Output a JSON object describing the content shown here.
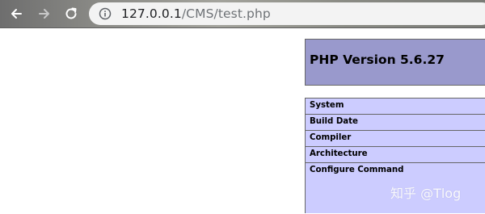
{
  "browser": {
    "url_host": "127.0.0.1",
    "url_path": "/CMS/test.php",
    "icons": [
      "back-arrow-icon",
      "forward-arrow-icon",
      "reload-icon",
      "info-icon"
    ]
  },
  "phpinfo": {
    "title": "PHP Version 5.6.27",
    "rows": [
      {
        "label": "System"
      },
      {
        "label": "Build Date"
      },
      {
        "label": "Compiler"
      },
      {
        "label": "Architecture"
      },
      {
        "label": "Configure Command"
      }
    ]
  },
  "colors": {
    "header_bg": "#9999cc",
    "row_bg": "#ccccff",
    "border": "#666666"
  },
  "watermark": {
    "text": "知乎 @Tlog"
  }
}
